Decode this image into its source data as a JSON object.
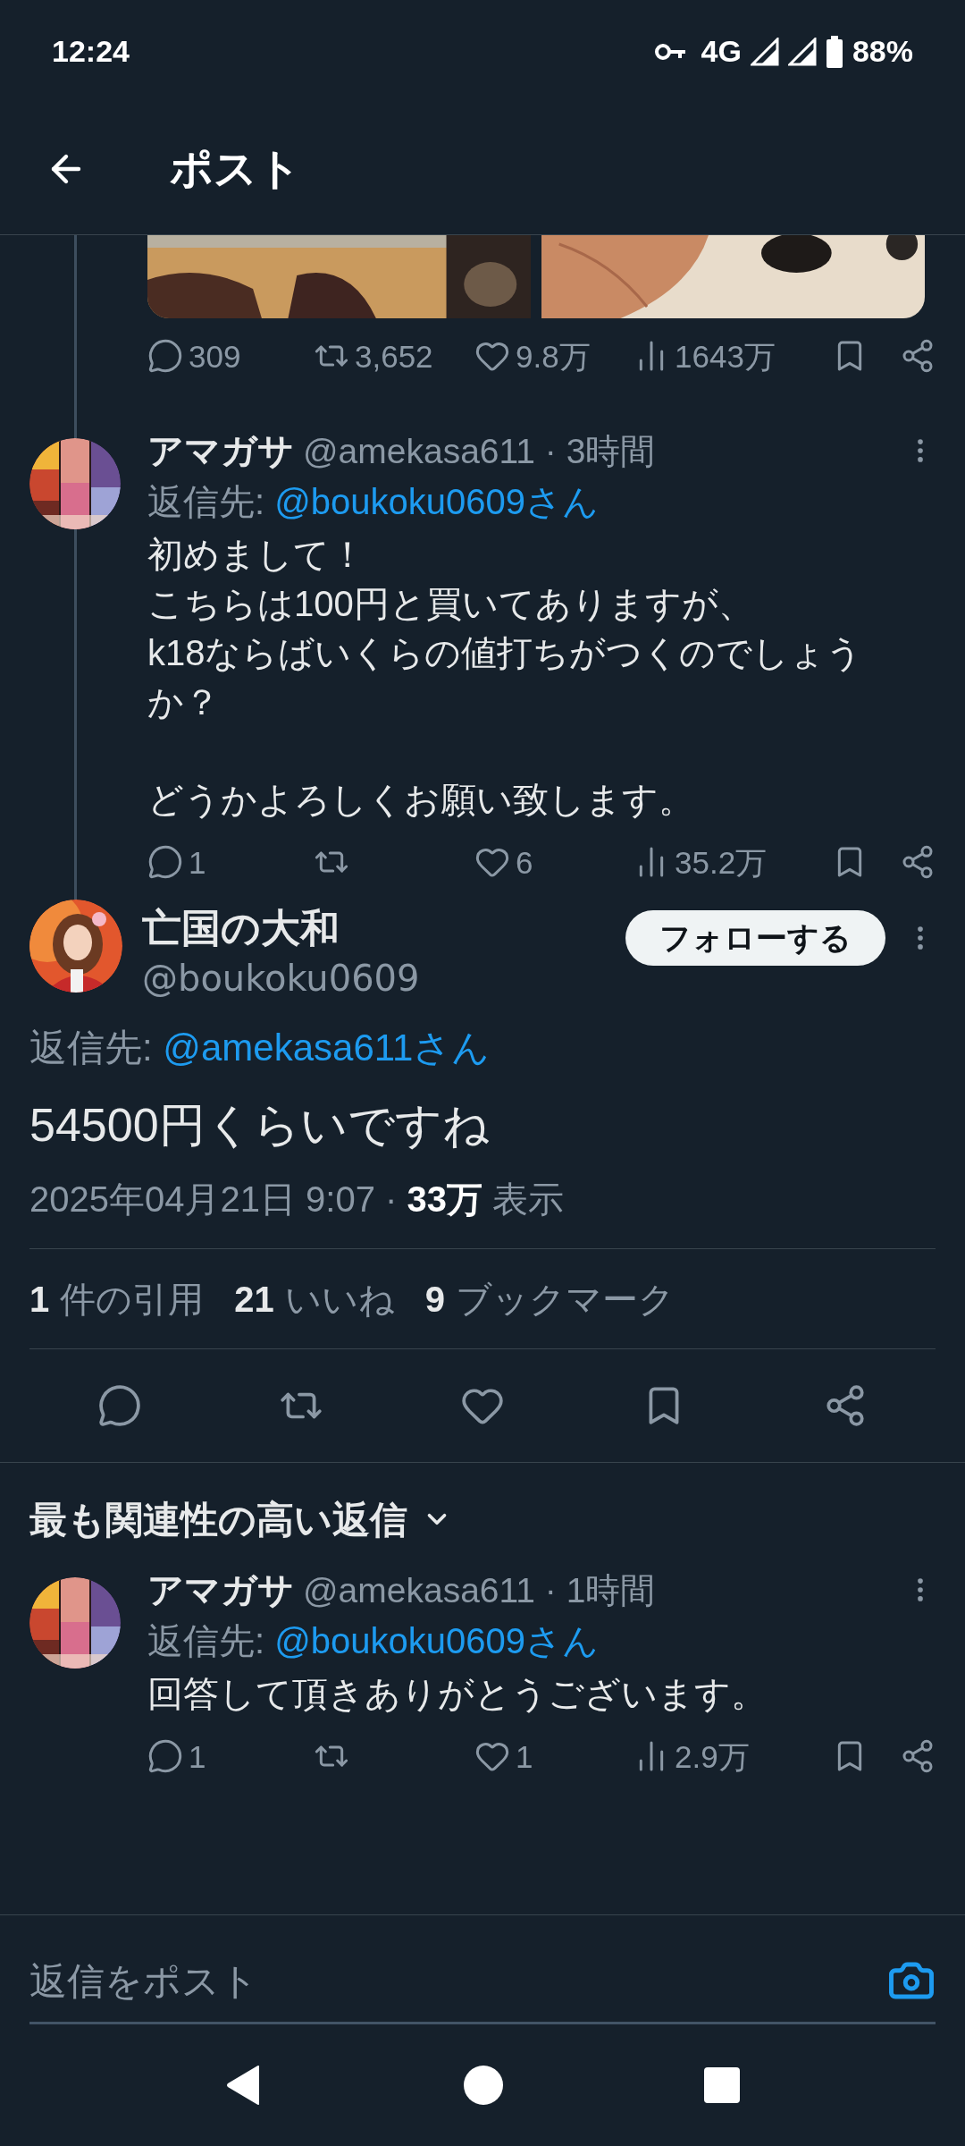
{
  "status_bar": {
    "time": "12:24",
    "network": "4G",
    "battery": "88%"
  },
  "header": {
    "title": "ポスト"
  },
  "top_post": {
    "actions": [
      {
        "kind": "reply",
        "count": "309"
      },
      {
        "kind": "repost",
        "count": "3,652"
      },
      {
        "kind": "like",
        "count": "9.8万"
      },
      {
        "kind": "views",
        "count": "1643万"
      },
      {
        "kind": "bookmark"
      },
      {
        "kind": "share"
      }
    ]
  },
  "thread_reply": {
    "name": "アマガサ",
    "meta": "@amekasa611 · 3時間",
    "reply_to": {
      "label": "返信先: ",
      "mention": "@boukoku0609さん"
    },
    "paragraphs": [
      {
        "lines": [
          "初めまして！",
          "こちらは100円と買いてありますが、",
          "k18ならばいくらの値打ちがつくのでしょうか？"
        ]
      },
      {
        "lines": [
          "どうかよろしくお願い致します。"
        ]
      }
    ],
    "actions": [
      {
        "kind": "reply",
        "count": "1"
      },
      {
        "kind": "repost"
      },
      {
        "kind": "like",
        "count": "6"
      },
      {
        "kind": "views",
        "count": "35.2万"
      },
      {
        "kind": "bookmark"
      },
      {
        "kind": "share"
      }
    ]
  },
  "main_post": {
    "name": "亡国の大和",
    "handle": "@boukoku0609",
    "follow_label": "フォローする",
    "reply_to": {
      "label": "返信先: ",
      "mention": "@amekasa611さん"
    },
    "text": "54500円くらいですね",
    "timestamp": "2025年04月21日 9:07 · **33万** 表示",
    "stats": [
      {
        "count": "1",
        "label": "件の引用"
      },
      {
        "count": "21",
        "label": "いいね"
      },
      {
        "count": "9",
        "label": "ブックマーク"
      }
    ],
    "actions": [
      {
        "kind": "reply"
      },
      {
        "kind": "repost"
      },
      {
        "kind": "like"
      },
      {
        "kind": "bookmark"
      },
      {
        "kind": "share"
      }
    ]
  },
  "replies_heading": "最も関連性の高い返信",
  "replies": [
    {
      "name": "アマガサ",
      "meta": "@amekasa611 · 1時間",
      "reply_to": {
        "label": "返信先: ",
        "mention": "@boukoku0609さん"
      },
      "paragraphs": [
        {
          "lines": [
            "回答して頂きありがとうございます。"
          ]
        }
      ],
      "actions": [
        {
          "kind": "reply",
          "count": "1"
        },
        {
          "kind": "repost"
        },
        {
          "kind": "like",
          "count": "1"
        },
        {
          "kind": "views",
          "count": "2.9万"
        },
        {
          "kind": "bookmark"
        },
        {
          "kind": "share"
        }
      ]
    }
  ],
  "composer": {
    "placeholder": "返信をポスト"
  }
}
